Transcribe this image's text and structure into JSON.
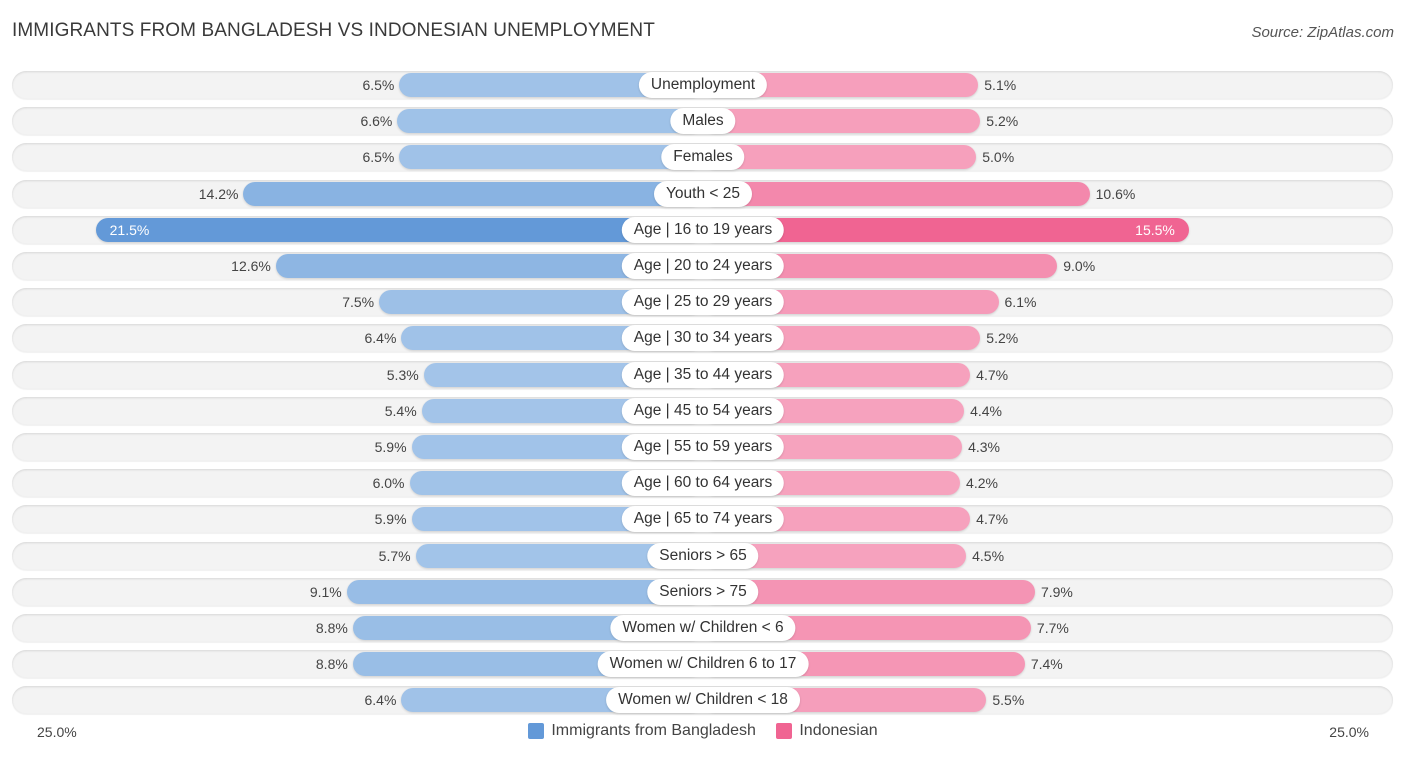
{
  "title": "IMMIGRANTS FROM BANGLADESH VS INDONESIAN UNEMPLOYMENT",
  "source": "Source: ZipAtlas.com",
  "colors": {
    "left_light": "#a7c7ea",
    "left_strong": "#6399d8",
    "right_light": "#f6a4bf",
    "right_strong": "#f06492",
    "row_bg": "#f3f3f3"
  },
  "chart_data": {
    "type": "bar",
    "orientation": "horizontal-diverging",
    "title": "IMMIGRANTS FROM BANGLADESH VS INDONESIAN UNEMPLOYMENT",
    "xlabel": "",
    "ylabel": "",
    "axis_min_label": "25.0%",
    "axis_max_label": "25.0%",
    "xlim": [
      0,
      25
    ],
    "unit": "%",
    "legend_position": "bottom-center",
    "categories": [
      "Unemployment",
      "Males",
      "Females",
      "Youth < 25",
      "Age | 16 to 19 years",
      "Age | 20 to 24 years",
      "Age | 25 to 29 years",
      "Age | 30 to 34 years",
      "Age | 35 to 44 years",
      "Age | 45 to 54 years",
      "Age | 55 to 59 years",
      "Age | 60 to 64 years",
      "Age | 65 to 74 years",
      "Seniors > 65",
      "Seniors > 75",
      "Women w/ Children < 6",
      "Women w/ Children 6 to 17",
      "Women w/ Children < 18"
    ],
    "series": [
      {
        "name": "Immigrants from Bangladesh",
        "side": "left",
        "values": [
          6.5,
          6.6,
          6.5,
          14.2,
          21.5,
          12.6,
          7.5,
          6.4,
          5.3,
          5.4,
          5.9,
          6.0,
          5.9,
          5.7,
          9.1,
          8.8,
          8.8,
          6.4
        ],
        "labels": [
          "6.5%",
          "6.6%",
          "6.5%",
          "14.2%",
          "21.5%",
          "12.6%",
          "7.5%",
          "6.4%",
          "5.3%",
          "5.4%",
          "5.9%",
          "6.0%",
          "5.9%",
          "5.7%",
          "9.1%",
          "8.8%",
          "8.8%",
          "6.4%"
        ]
      },
      {
        "name": "Indonesian",
        "side": "right",
        "values": [
          5.1,
          5.2,
          5.0,
          10.6,
          15.5,
          9.0,
          6.1,
          5.2,
          4.7,
          4.4,
          4.3,
          4.2,
          4.7,
          4.5,
          7.9,
          7.7,
          7.4,
          5.5
        ],
        "labels": [
          "5.1%",
          "5.2%",
          "5.0%",
          "10.6%",
          "15.5%",
          "9.0%",
          "6.1%",
          "5.2%",
          "4.7%",
          "4.4%",
          "4.3%",
          "4.2%",
          "4.7%",
          "4.5%",
          "7.9%",
          "7.7%",
          "7.4%",
          "5.5%"
        ]
      }
    ],
    "highlighted_category": "Age | 16 to 19 years"
  },
  "legend": {
    "items": [
      {
        "label": "Immigrants from Bangladesh",
        "color": "#6399d8"
      },
      {
        "label": "Indonesian",
        "color": "#f06492"
      }
    ]
  }
}
